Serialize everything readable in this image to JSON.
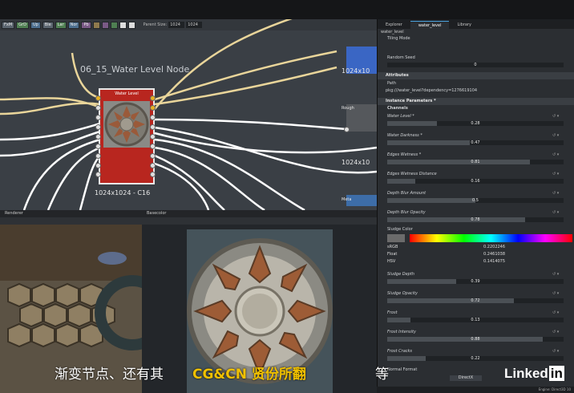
{
  "graph": {
    "toolbar": [
      "FxM",
      "GrD",
      "Up",
      "Ble",
      "Lar",
      "Nor",
      "Pb"
    ],
    "parent_size_label": "Parent Size:",
    "size_a": "1024",
    "size_b": "1024",
    "frame_label": "06_15_Water Level Node",
    "node_title": "Water Level",
    "node_caption": "1024x1024 - C16",
    "side_labels": [
      "1024x10",
      "Rough",
      "1024x10",
      "Meta"
    ]
  },
  "render_title": "Renderer",
  "base_title": "Basecolor",
  "subtitle": "渐变节点、还有其",
  "watermark": "CG&CN 贤份所翻",
  "subtitle_end": "等",
  "logo_a": "Linked",
  "logo_b": "in",
  "panel": {
    "tabs": [
      "Explorer",
      "water_level",
      "Library"
    ],
    "crumb": "water_level",
    "tiling_mode": "Tiling Mode",
    "random_seed": "Random Seed",
    "random_seed_value": "0",
    "attributes": "Attributes",
    "path_label": "Path",
    "path_value": "pkg:///water_level?dependency=1276619104",
    "instance_params": "Instance Parameters *",
    "channels": "Channels",
    "params": [
      {
        "label": "Water Level *",
        "value": "0.28",
        "fill": 0.28
      },
      {
        "label": "Water Darkness *",
        "value": "0.47",
        "fill": 0.47
      },
      {
        "label": "Edges Wetness *",
        "value": "0.81",
        "fill": 0.81
      },
      {
        "label": "Edges Wetness Distance",
        "value": "0.16",
        "fill": 0.16
      },
      {
        "label": "Depth Blur Amount",
        "value": "0.5",
        "fill": 0.5
      },
      {
        "label": "Depth Blur Opacity",
        "value": "0.78",
        "fill": 0.78
      }
    ],
    "sludge_color": "Sludge Color",
    "rgb_label": "sRGB",
    "float_label": "Float",
    "hsv_label": "HSV",
    "rgb_values": [
      "0.2202246",
      "0.2461038",
      "0.1414075"
    ],
    "params2": [
      {
        "label": "Sludge Depth",
        "value": "0.39",
        "fill": 0.39
      },
      {
        "label": "Sludge Opacity",
        "value": "0.72",
        "fill": 0.72
      },
      {
        "label": "Frost",
        "value": "0.13",
        "fill": 0.13
      },
      {
        "label": "Frost Intensity",
        "value": "0.88",
        "fill": 0.88
      },
      {
        "label": "Frost Cracks",
        "value": "0.22",
        "fill": 0.22
      }
    ],
    "normal_format": "Normal Format",
    "normal_value": "DirectX",
    "status": "Engine: Direct3D 10"
  }
}
